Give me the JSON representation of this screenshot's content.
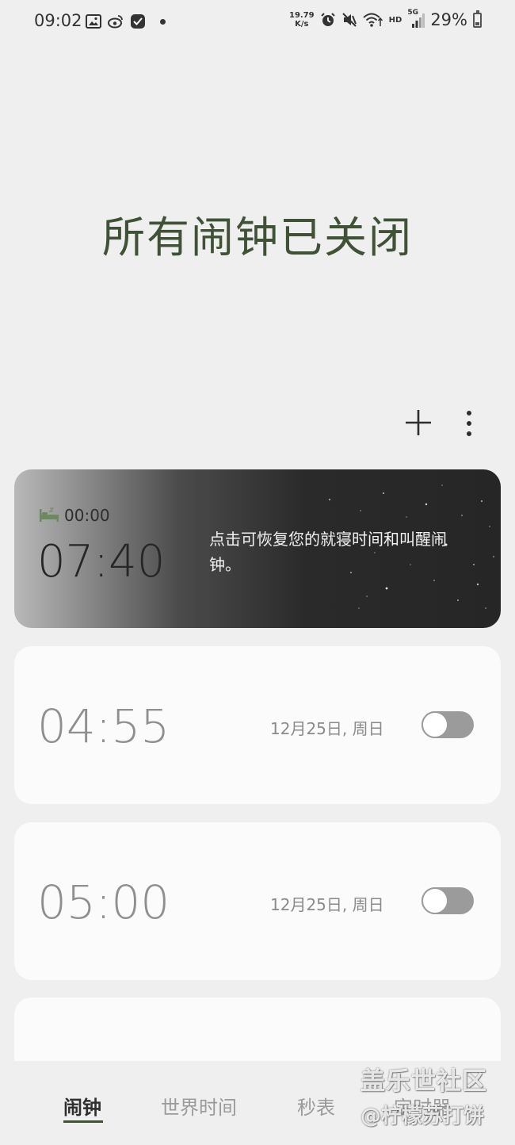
{
  "status_bar": {
    "time": "09:02",
    "network_speed_value": "19.79",
    "network_speed_unit": "K/s",
    "hd_label": "HD",
    "signal_label": "5G",
    "battery_percent": "29%",
    "battery_level": 0.29,
    "icons": [
      "image-icon",
      "weibo-icon",
      "app-icon",
      "notification-dot",
      "alarm-icon",
      "mute-icon",
      "wifi-icon",
      "signal-icon",
      "battery-icon"
    ]
  },
  "header": {
    "title": "所有闹钟已关闭",
    "add_icon": "plus-icon",
    "more_icon": "more-vertical-icon"
  },
  "bedtime_card": {
    "bedtime": "00:00",
    "wake_time": "07:40",
    "message": "点击可恢复您的就寝时间和叫醒闹钟。",
    "icon": "bed-icon"
  },
  "alarms": [
    {
      "time": "04:55",
      "date": "12月25日, 周日",
      "enabled": false
    },
    {
      "time": "05:00",
      "date": "12月25日, 周日",
      "enabled": false
    }
  ],
  "bottom_nav": {
    "tabs": [
      "闹钟",
      "世界时间",
      "秒表",
      "定时器"
    ],
    "active": "闹钟"
  },
  "watermark": {
    "line1": "盖乐世社区",
    "line2": "@柠檬苏打饼"
  },
  "colors": {
    "accent": "#3f5236",
    "background": "#efefef",
    "card": "#fbfbfb",
    "toggle_off": "#9b9b9b"
  }
}
